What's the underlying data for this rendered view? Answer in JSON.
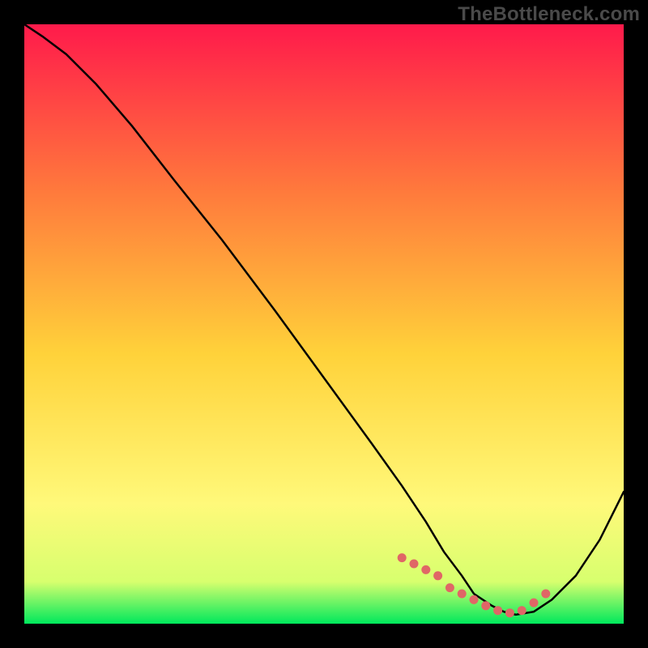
{
  "watermark": "TheBottleneck.com",
  "colors": {
    "frame_background": "#000000",
    "gradient_top": "#ff1a4b",
    "gradient_upper_mid": "#ff7a3c",
    "gradient_mid": "#ffd23a",
    "gradient_lower_mid": "#fff97a",
    "gradient_near_bottom": "#d7ff6e",
    "gradient_bottom": "#00e85c",
    "curve_stroke": "#000000",
    "marker_fill": "#e06666"
  },
  "chart_data": {
    "type": "line",
    "title": "",
    "xlabel": "",
    "ylabel": "",
    "xlim": [
      0,
      100
    ],
    "ylim": [
      0,
      100
    ],
    "series": [
      {
        "name": "curve",
        "x": [
          0,
          3,
          7,
          12,
          18,
          25,
          33,
          42,
          50,
          58,
          63,
          67,
          70,
          73,
          75,
          78,
          80,
          82,
          85,
          88,
          92,
          96,
          100
        ],
        "values": [
          100,
          98,
          95,
          90,
          83,
          74,
          64,
          52,
          41,
          30,
          23,
          17,
          12,
          8,
          5,
          3,
          2,
          1.5,
          2,
          4,
          8,
          14,
          22
        ]
      }
    ],
    "markers": {
      "name": "highlight-dots",
      "x": [
        63,
        65,
        67,
        69,
        71,
        73,
        75,
        77,
        79,
        81,
        83,
        85,
        87
      ],
      "values": [
        11,
        10,
        9,
        8,
        6,
        5,
        4,
        3,
        2.2,
        1.8,
        2.2,
        3.5,
        5
      ]
    }
  }
}
